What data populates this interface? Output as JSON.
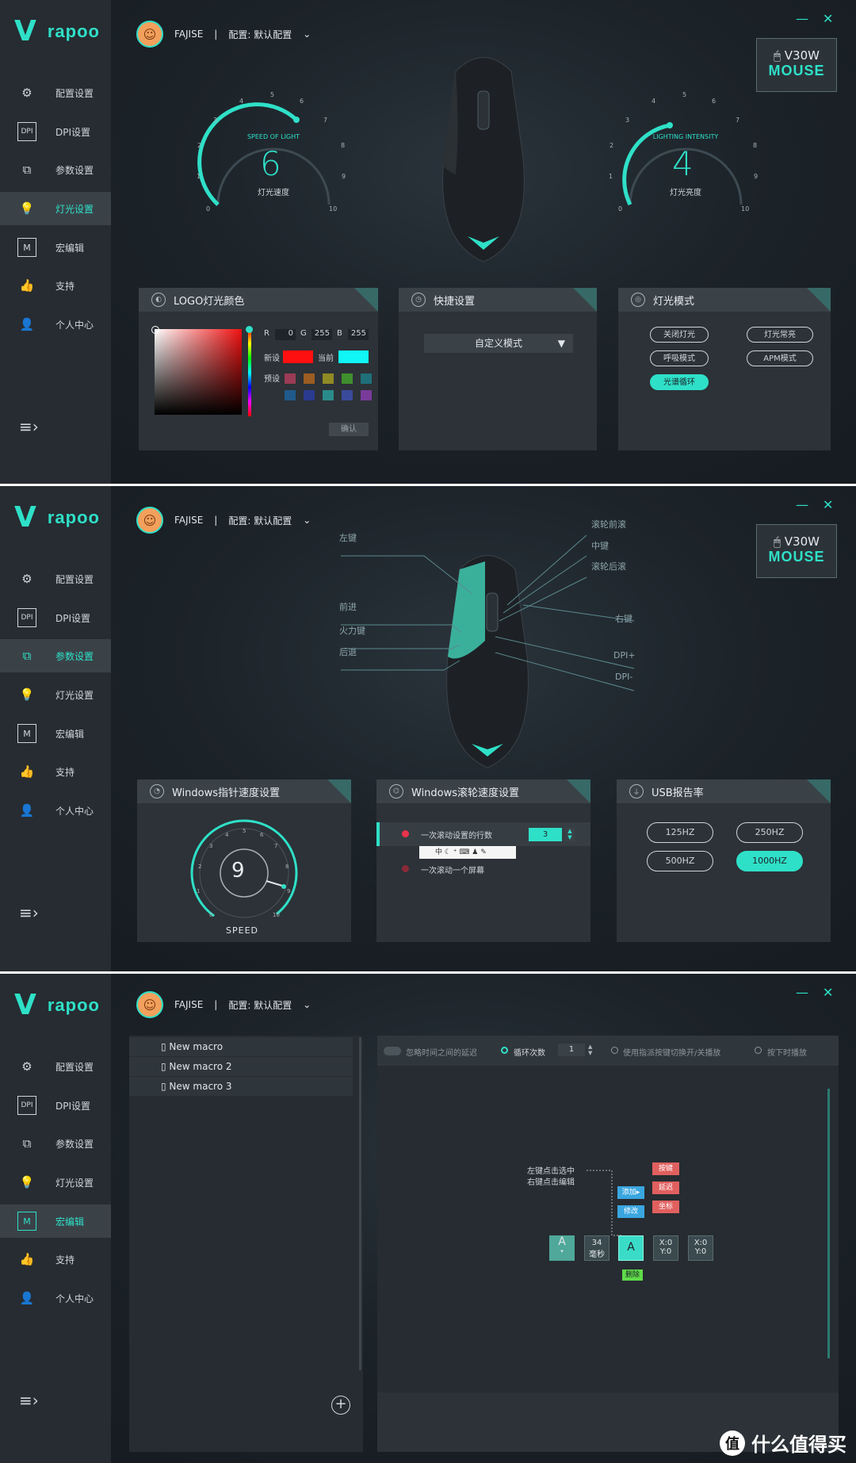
{
  "brand": {
    "logo_mark": "V",
    "logo_text": "rapoo"
  },
  "header": {
    "user": "FAJISE",
    "separator": "|",
    "config": "配置: 默认配置"
  },
  "window": {
    "minimize": "—",
    "close": "✕"
  },
  "device_badge": {
    "model": "V30W",
    "type": "MOUSE"
  },
  "nav": [
    {
      "label": "配置设置",
      "icon": "⚙"
    },
    {
      "label": "DPI设置",
      "icon": "DPI"
    },
    {
      "label": "参数设置",
      "icon": "⧉"
    },
    {
      "label": "灯光设置",
      "icon": "💡"
    },
    {
      "label": "宏编辑",
      "icon": "M"
    },
    {
      "label": "支持",
      "icon": "👍"
    },
    {
      "label": "个人中心",
      "icon": "👤"
    }
  ],
  "panel1": {
    "gauge_speed": {
      "caption_en": "SPEED OF LIGHT",
      "value": "6",
      "caption_cn": "灯光速度",
      "ticks": [
        "0",
        "1",
        "2",
        "3",
        "4",
        "5",
        "6",
        "7",
        "8",
        "9",
        "10"
      ]
    },
    "gauge_intensity": {
      "caption_en": "LIGHTING INTENSITY",
      "value": "4",
      "caption_cn": "灯光亮度",
      "ticks": [
        "0",
        "1",
        "2",
        "3",
        "4",
        "5",
        "6",
        "7",
        "8",
        "9",
        "10"
      ]
    },
    "logo_color": {
      "title": "LOGO灯光颜色",
      "r_label": "R",
      "r": "0",
      "g_label": "G",
      "g": "255",
      "b_label": "B",
      "b": "255",
      "new_label": "新设",
      "new_color": "#ff1010",
      "current_label": "当前",
      "current_color": "#10f5f5",
      "preset_label": "预设",
      "presets": [
        "#9b3b55",
        "#9b5d22",
        "#8f8a24",
        "#3f8f2e",
        "#1f6f7a",
        "#1f5a8a",
        "#2a3a8f",
        "#2a8a8a",
        "#3a4a9a",
        "#7a3a9a"
      ],
      "confirm": "确认"
    },
    "quick": {
      "title": "快捷设置",
      "mode": "自定义模式"
    },
    "light_mode": {
      "title": "灯光模式",
      "options": [
        "关闭灯光",
        "灯光常亮",
        "呼吸模式",
        "APM模式",
        "光谱循环"
      ],
      "selected": "光谱循环"
    }
  },
  "panel2": {
    "callouts": {
      "left": [
        "左键",
        "前进",
        "火力键",
        "后退"
      ],
      "right": [
        "滚轮前滚",
        "中键",
        "滚轮后滚",
        "右键",
        "DPI+",
        "DPI-"
      ]
    },
    "pointer": {
      "title": "Windows指针速度设置",
      "value": "9",
      "label": "SPEED",
      "ticks": [
        "0",
        "1",
        "2",
        "3",
        "4",
        "5",
        "6",
        "7",
        "8",
        "9",
        "10"
      ]
    },
    "scroll": {
      "title": "Windows滚轮速度设置",
      "opt1": "一次滚动设置的行数",
      "opt1_value": "3",
      "opt2": "一次滚动一个屏幕",
      "ime_bar": "中"
    },
    "usb": {
      "title": "USB报告率",
      "rates": [
        "125HZ",
        "250HZ",
        "500HZ",
        "1000HZ"
      ],
      "selected": "1000HZ"
    }
  },
  "panel3": {
    "macros": [
      "New macro",
      "New macro 2",
      "New macro 3"
    ],
    "add_button": "+",
    "options": {
      "ignore_delay": "忽略时间之间的延迟",
      "loop": "循环次数",
      "loop_value": "1",
      "toggle": "使用指派按键切换开/关播放",
      "hold": "按下时播放"
    },
    "hint": [
      "左键点击选中",
      "右键点击编辑"
    ],
    "menu": {
      "add": "添加▸",
      "edit": "修改",
      "key": "按键",
      "delay": "延迟",
      "coord": "坐标",
      "delete": "删除"
    },
    "events": [
      {
        "top": "A",
        "bottom": "▾"
      },
      {
        "top": "34",
        "bottom": "毫秒"
      },
      {
        "top": "A",
        "bottom": ""
      },
      {
        "top": "X:0",
        "bottom": "Y:0"
      },
      {
        "top": "X:0",
        "bottom": "Y:0"
      }
    ]
  },
  "watermark": {
    "icon": "值",
    "text": "什么值得买"
  }
}
